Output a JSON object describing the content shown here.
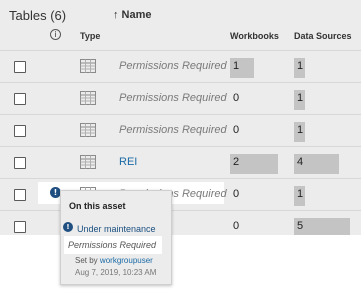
{
  "header": {
    "title": "Tables (6)",
    "columns": {
      "info_icon": "i",
      "type": "Type",
      "name": "↑ Name",
      "workbooks": "Workbooks",
      "data_sources": "Data Sources"
    }
  },
  "rows": [
    {
      "name": "Permissions Required",
      "workbooks": "1",
      "data_sources": "1",
      "workbooks_bar": 0.2,
      "data_sources_bar": 0.2
    },
    {
      "name": "Permissions Required",
      "workbooks": "0",
      "data_sources": "1",
      "workbooks_bar": 0,
      "data_sources_bar": 0.2
    },
    {
      "name": "Permissions Required",
      "workbooks": "0",
      "data_sources": "1",
      "workbooks_bar": 0,
      "data_sources_bar": 0.2
    },
    {
      "name": "REI",
      "workbooks": "2",
      "data_sources": "4",
      "workbooks_bar": 0.4,
      "data_sources_bar": 0.8
    },
    {
      "name": "Permissions Required",
      "workbooks": "0",
      "data_sources": "1",
      "workbooks_bar": 0,
      "data_sources_bar": 0.2,
      "warning": "!"
    },
    {
      "name": "",
      "workbooks": "0",
      "data_sources": "5",
      "workbooks_bar": 0,
      "data_sources_bar": 1.0
    }
  ],
  "popup": {
    "title": "On this asset",
    "status_icon": "!",
    "status": "Under maintenance",
    "message": "Permissions Required",
    "set_by_prefix": "Set by",
    "set_by_user": "workgroupuser",
    "date": "Aug 7, 2019, 10:23 AM"
  },
  "colors": {
    "panel_bg": "#ececec",
    "bar": "#c4c4c4",
    "link": "#1a6aa6",
    "warning_dot": "#1f4f80"
  }
}
